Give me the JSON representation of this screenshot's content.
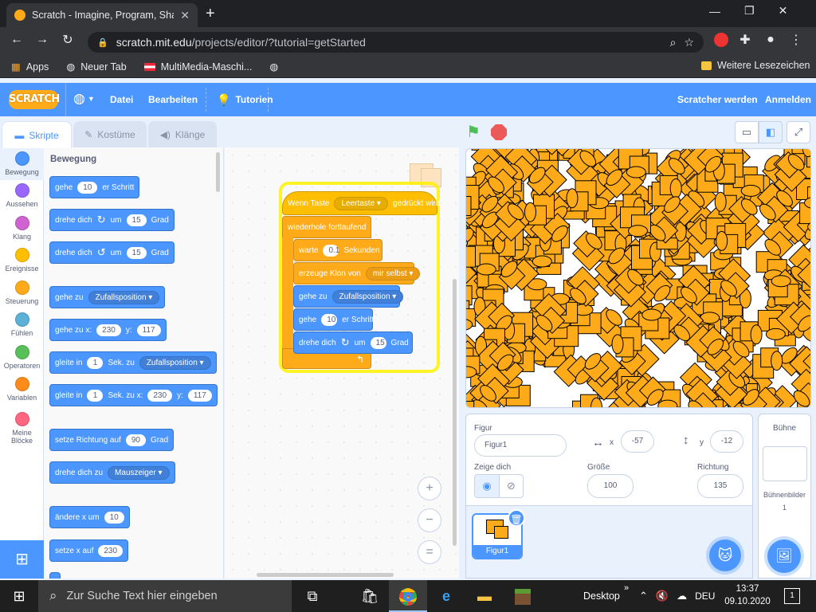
{
  "browser": {
    "tab_title": "Scratch - Imagine, Program, Shar",
    "url_host": "scratch.mit.edu",
    "url_path": "/projects/editor/?tutorial=getStarted",
    "bookmarks": [
      "Apps",
      "Neuer Tab",
      "MultiMedia-Maschi...",
      ""
    ],
    "bookmarks_right": "Weitere Lesezeichen"
  },
  "menu": {
    "logo": "SCRATCH",
    "file": "Datei",
    "edit": "Bearbeiten",
    "tutorials": "Tutorien",
    "join": "Scratcher werden",
    "signin": "Anmelden"
  },
  "editor_tabs": {
    "code": "Skripte",
    "costumes": "Kostüme",
    "sounds": "Klänge"
  },
  "categories": [
    {
      "label": "Bewegung",
      "color": "#4c97ff"
    },
    {
      "label": "Aussehen",
      "color": "#9966ff"
    },
    {
      "label": "Klang",
      "color": "#cf63cf"
    },
    {
      "label": "Ereignisse",
      "color": "#ffbf00"
    },
    {
      "label": "Steuerung",
      "color": "#ffab19"
    },
    {
      "label": "Fühlen",
      "color": "#5cb1d6"
    },
    {
      "label": "Operatoren",
      "color": "#59c059"
    },
    {
      "label": "Variablen",
      "color": "#ff8c1a"
    },
    {
      "label": "Meine Blöcke",
      "color": "#ff6680"
    }
  ],
  "palette": {
    "heading": "Bewegung",
    "b1": {
      "a": "gehe",
      "v": "10",
      "b": "er Schritt"
    },
    "b2": {
      "a": "drehe dich",
      "b": "um",
      "v": "15",
      "c": "Grad"
    },
    "b3": {
      "a": "drehe dich",
      "b": "um",
      "v": "15",
      "c": "Grad"
    },
    "b4": {
      "a": "gehe zu",
      "d": "Zufallsposition"
    },
    "b5": {
      "a": "gehe zu x:",
      "x": "230",
      "b": "y:",
      "y": "117"
    },
    "b6": {
      "a": "gleite in",
      "v": "1",
      "b": "Sek. zu",
      "d": "Zufallsposition"
    },
    "b7": {
      "a": "gleite in",
      "v": "1",
      "b": "Sek. zu x:",
      "x": "230",
      "c": "y:",
      "y": "117"
    },
    "b8": {
      "a": "setze Richtung auf",
      "v": "90",
      "b": "Grad"
    },
    "b9": {
      "a": "drehe dich zu",
      "d": "Mauszeiger"
    },
    "b10": {
      "a": "ändere x um",
      "v": "10"
    },
    "b11": {
      "a": "setze x auf",
      "v": "230"
    }
  },
  "script": {
    "hat": {
      "a": "Wenn Taste",
      "d": "Leertaste",
      "b": "gedrückt wird"
    },
    "forever": "wiederhole fortlaufend",
    "wait": {
      "a": "warte",
      "v": "0.1",
      "b": "Sekunden"
    },
    "clone": {
      "a": "erzeuge Klon von",
      "d": "mir selbst"
    },
    "goto": {
      "a": "gehe zu",
      "d": "Zufallsposition"
    },
    "move": {
      "a": "gehe",
      "v": "10",
      "b": "er Schritt"
    },
    "turn": {
      "a": "drehe dich",
      "b": "um",
      "v": "15",
      "c": "Grad"
    },
    "zoom_in": "+",
    "zoom_out": "−",
    "zoom_reset": "="
  },
  "sprite_info": {
    "label_sprite": "Figur",
    "name": "Figur1",
    "label_x": "x",
    "x": "-57",
    "label_y": "y",
    "y": "-12",
    "label_show": "Zeige dich",
    "label_size": "Größe",
    "size": "100",
    "label_direction": "Richtung",
    "direction": "135",
    "thumb_label": "Figur1"
  },
  "stage_panel": {
    "title": "Bühne",
    "backdrops_label": "Bühnenbilder",
    "backdrops_count": "1"
  },
  "taskbar": {
    "search_placeholder": "Zur Suche Text hier eingeben",
    "desktop": "Desktop",
    "lang": "DEU",
    "time": "13:37",
    "date": "09.10.2020",
    "notifications": "1"
  },
  "colors": {
    "motion": "#4c97ff",
    "events": "#ffbf00",
    "control": "#ffab19",
    "menu": "#4c97ff",
    "sprite_fill": "#ffab19"
  }
}
